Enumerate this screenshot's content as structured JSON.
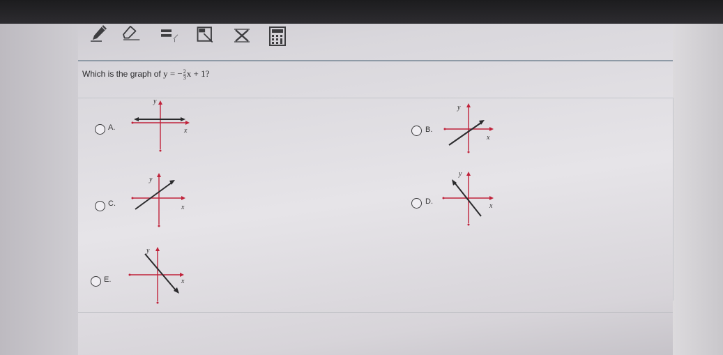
{
  "toolbar": {
    "tools": [
      "pencil-icon",
      "eraser-icon",
      "line-tool-icon",
      "selection-tool-icon",
      "delete-icon",
      "calculator-icon"
    ]
  },
  "question": {
    "prefix": "Which is the graph of ",
    "eq_lhs": "y = −",
    "frac_num": "2",
    "frac_den": "3",
    "eq_rhs": "x + 1?"
  },
  "options": [
    {
      "letter": "A.",
      "line": "horizontal"
    },
    {
      "letter": "B.",
      "line": "rising"
    },
    {
      "letter": "C.",
      "line": "rising"
    },
    {
      "letter": "D.",
      "line": "falling"
    },
    {
      "letter": "E.",
      "line": "falling"
    }
  ],
  "axis_labels": {
    "x": "x",
    "y": "y"
  },
  "colors": {
    "axis": "#c0223a",
    "line": "#2a2a2c",
    "rule": "#8e9aa6"
  }
}
